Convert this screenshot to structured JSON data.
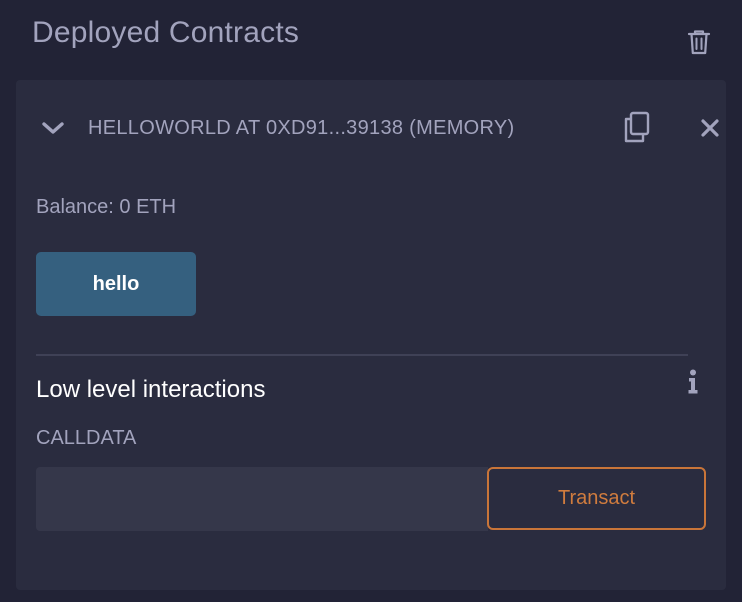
{
  "section": {
    "title": "Deployed Contracts",
    "clear_icon": "trash-icon"
  },
  "contract": {
    "expand_icon": "chevron-down-icon",
    "name": "HELLOWORLD AT 0XD91...39138 (MEMORY)",
    "copy_icon": "copy-icon",
    "remove_icon": "close-icon",
    "balance": "Balance: 0 ETH",
    "functions": [
      {
        "label": "hello"
      }
    ]
  },
  "low_level": {
    "title": "Low level interactions",
    "info_icon": "info-icon",
    "calldata_label": "CALLDATA",
    "calldata_value": "",
    "transact_label": "Transact"
  },
  "colors": {
    "background": "#222336",
    "card": "#2a2c3f",
    "muted_text": "#a2a3bd",
    "call_button": "#35607f",
    "transact_accent": "#c97539"
  }
}
